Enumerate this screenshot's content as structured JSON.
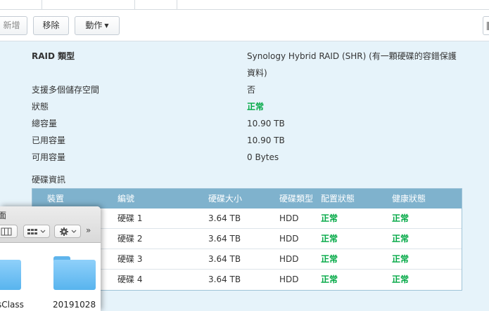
{
  "toolbar": {
    "add_label": "新增",
    "remove_label": "移除",
    "action_label": "動作"
  },
  "details": {
    "raid_type": {
      "label": "RAID 類型",
      "value_line1": "Synology Hybrid RAID (SHR) (有一顆硬碟的容錯保護",
      "value_line2": "資料)"
    },
    "multi_volume": {
      "label": "支援多個儲存空間",
      "value": "否"
    },
    "status": {
      "label": "狀態",
      "value": "正常"
    },
    "total_capacity": {
      "label": "總容量",
      "value": "10.90 TB"
    },
    "used_capacity": {
      "label": "已用容量",
      "value": "10.90 TB"
    },
    "available_capacity": {
      "label": "可用容量",
      "value": "0 Bytes"
    }
  },
  "disk_info": {
    "title": "硬碟資訊",
    "columns": [
      "裝置",
      "編號",
      "硬碟大小",
      "硬碟類型",
      "配置狀態",
      "健康狀態"
    ],
    "rows": [
      {
        "number": "硬碟 1",
        "size": "3.64 TB",
        "type": "HDD",
        "allocation": "正常",
        "health": "正常"
      },
      {
        "number": "硬碟 2",
        "size": "3.64 TB",
        "type": "HDD",
        "allocation": "正常",
        "health": "正常"
      },
      {
        "number": "硬碟 3",
        "size": "3.64 TB",
        "type": "HDD",
        "allocation": "正常",
        "health": "正常"
      },
      {
        "number": "硬碟 4",
        "size": "3.64 TB",
        "type": "HDD",
        "allocation": "正常",
        "health": "正常"
      }
    ]
  },
  "finder": {
    "title": "面",
    "chevron": "»",
    "folders": [
      {
        "name": "sClass"
      },
      {
        "name": "20191028"
      }
    ]
  },
  "colors": {
    "panel_bg": "#e6f3fa",
    "table_header": "#7fb2cd",
    "status_green": "#00a844"
  }
}
